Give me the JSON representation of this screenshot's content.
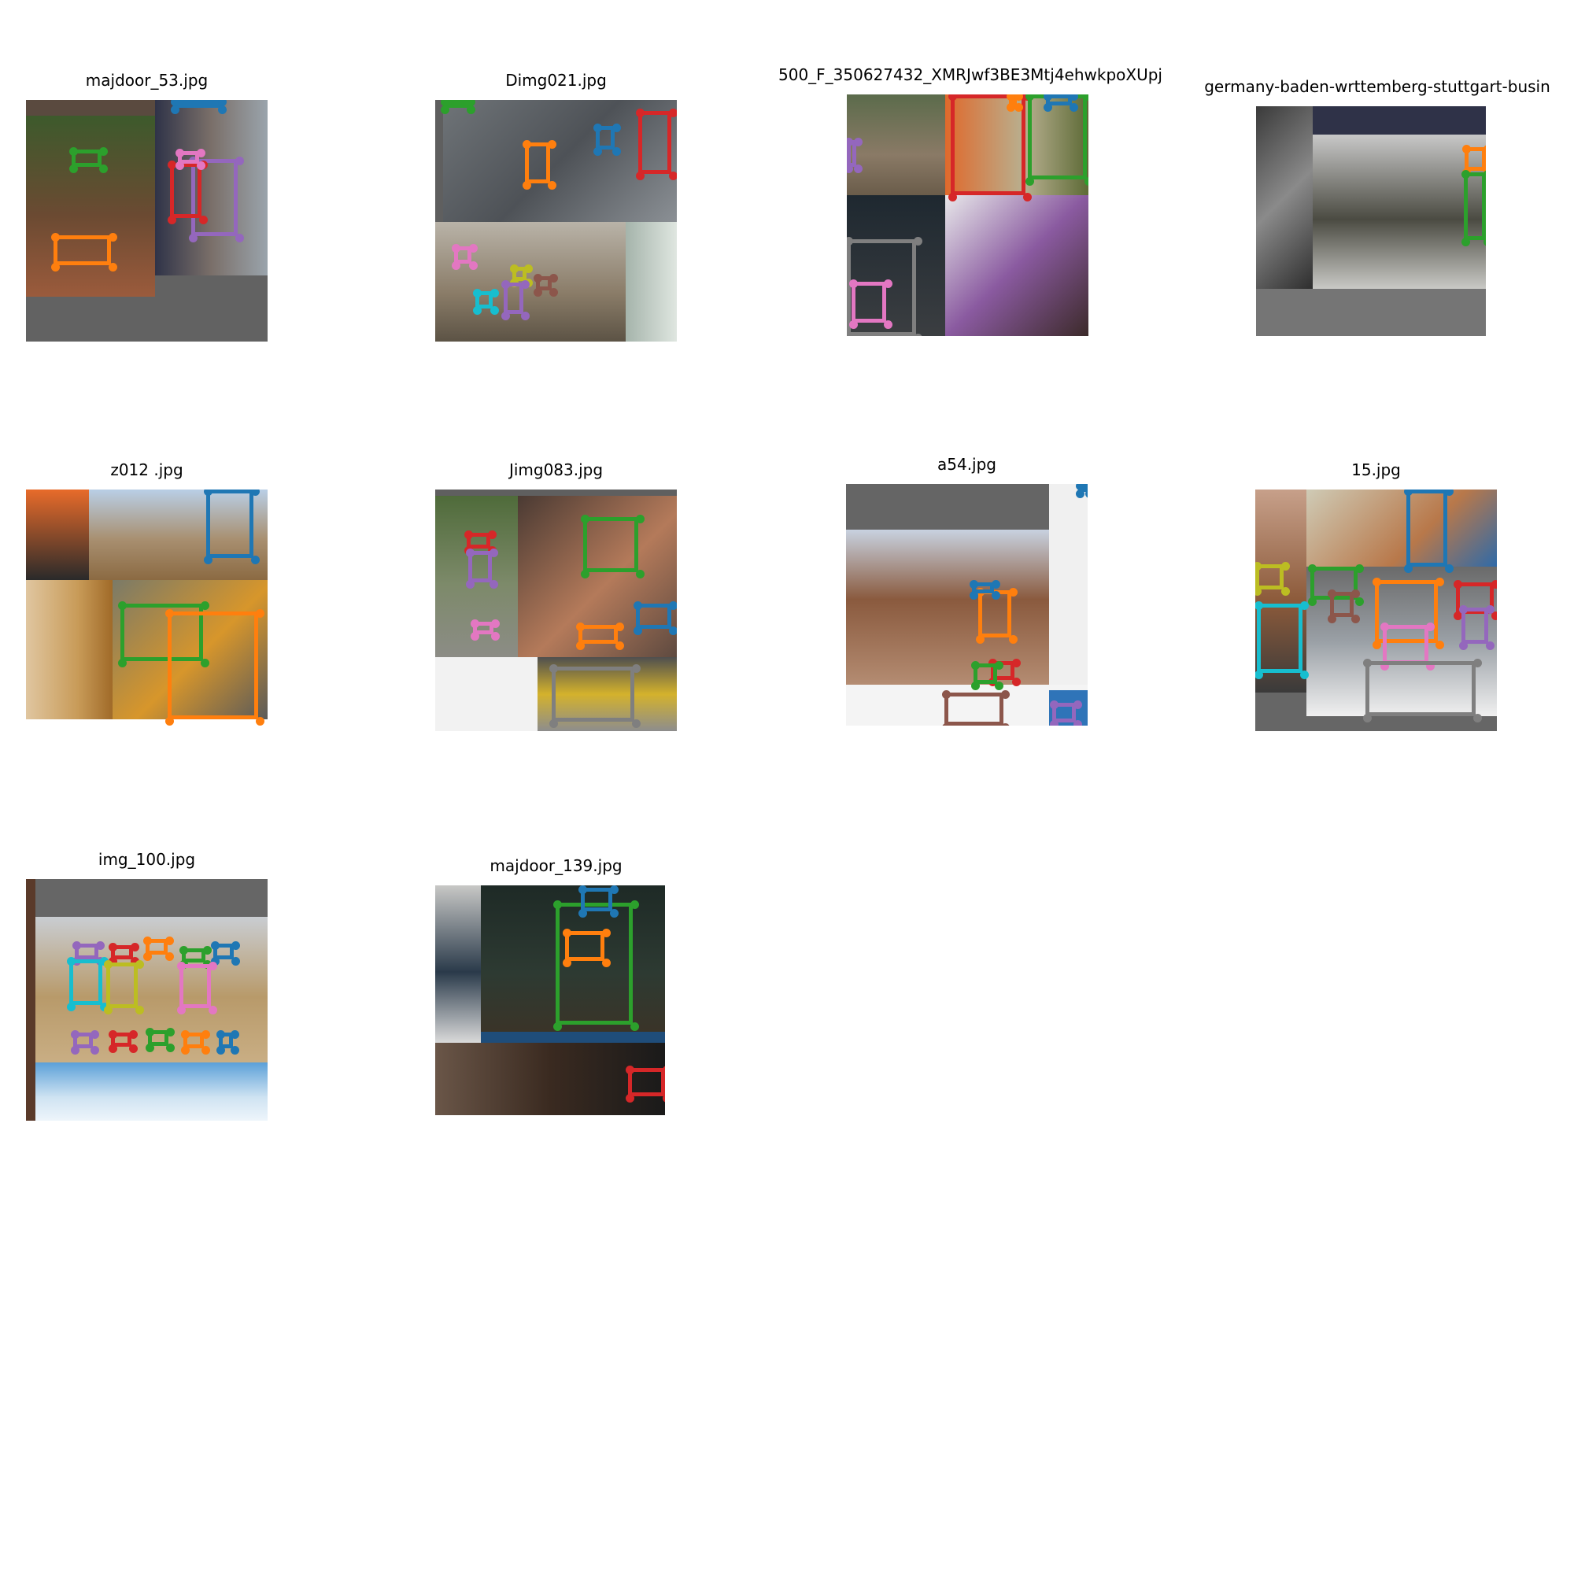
{
  "panels": [
    {
      "title": "majdoor_53.jpg"
    },
    {
      "title": "Dimg021.jpg"
    },
    {
      "title": "500_F_350627432_XMRJwf3BE3Mtj4ehwkpoXUpj"
    },
    {
      "title": "germany-baden-wrttemberg-stuttgart-busin"
    },
    {
      "title": "z012 .jpg"
    },
    {
      "title": "Jimg083.jpg"
    },
    {
      "title": "a54.jpg"
    },
    {
      "title": "15.jpg"
    },
    {
      "title": "img_100.jpg"
    },
    {
      "title": "majdoor_139.jpg"
    }
  ],
  "colors": {
    "blue": "#1f77b4",
    "orange": "#ff7f0e",
    "green": "#2ca02c",
    "red": "#d62728",
    "purple": "#9467bd",
    "brown": "#8c564b",
    "pink": "#e377c2",
    "gray": "#7f7f7f",
    "olive": "#bcbd22",
    "cyan": "#17becf"
  }
}
